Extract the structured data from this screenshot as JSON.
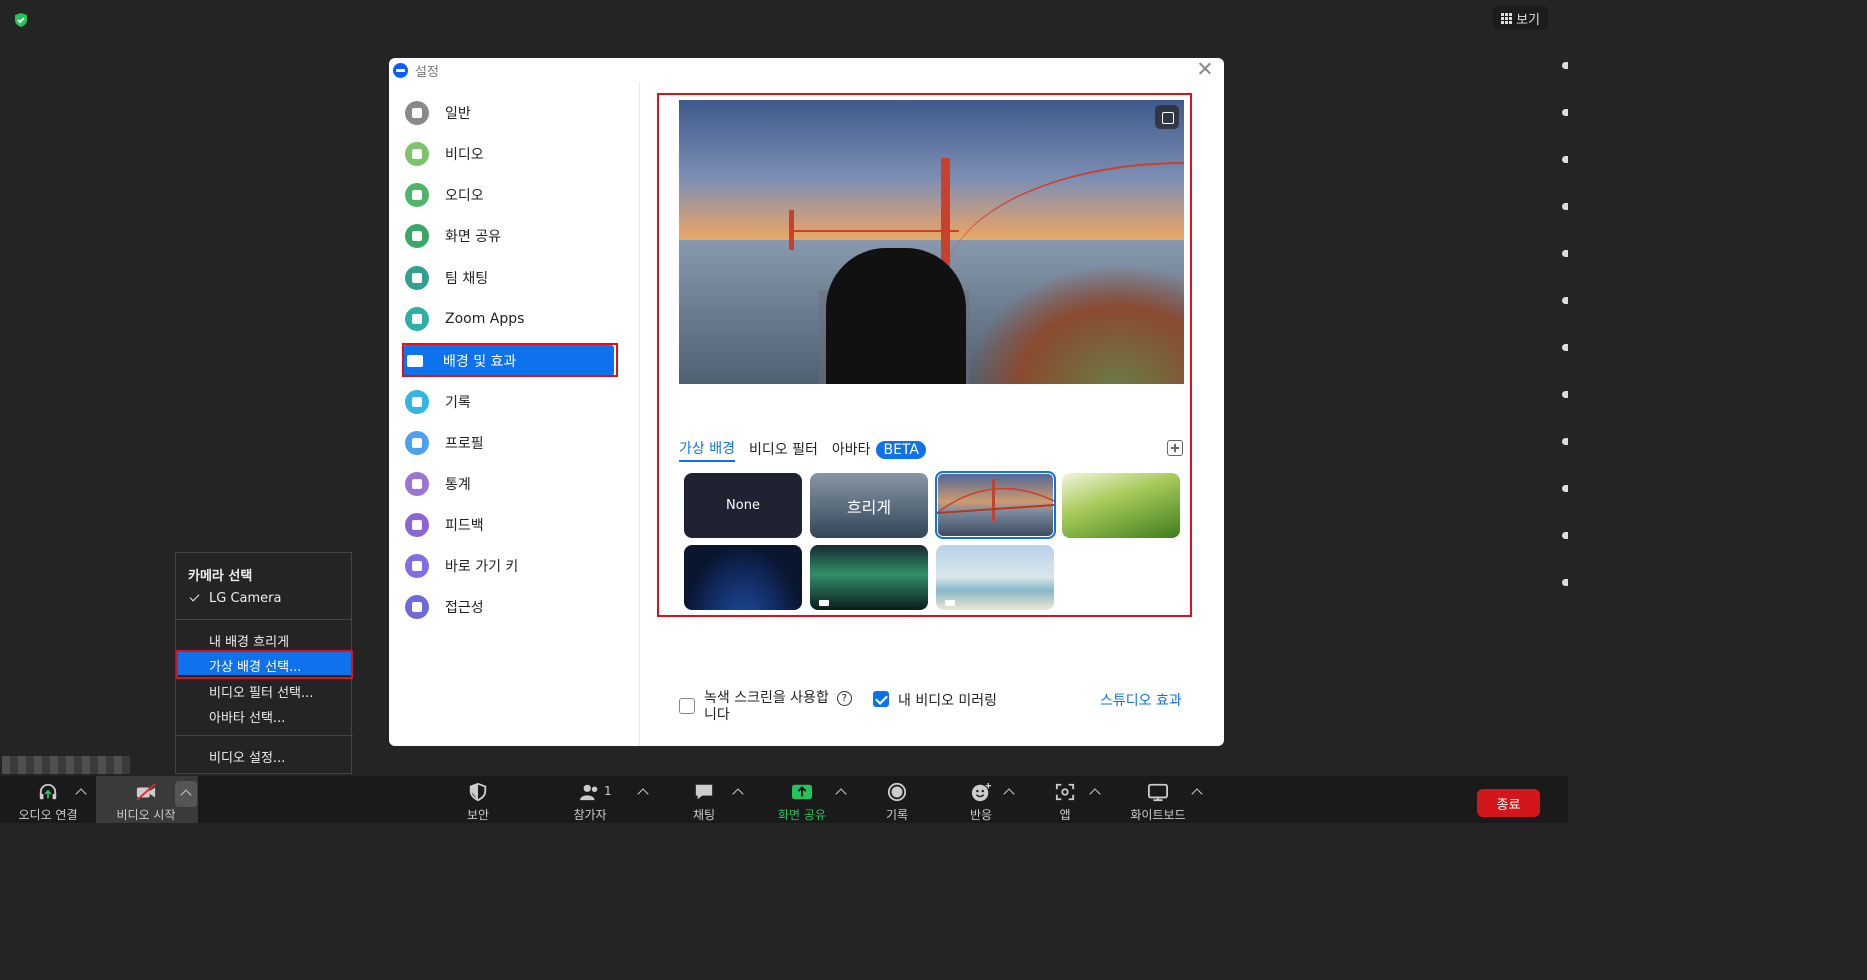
{
  "topbar": {
    "view_label": "보기"
  },
  "dialog": {
    "title": "설정",
    "nav": [
      {
        "label": "일반",
        "icon": "gear-icon",
        "color": "#8a8a8a"
      },
      {
        "label": "비디오",
        "icon": "video-icon",
        "color": "#7cc36b"
      },
      {
        "label": "오디오",
        "icon": "headphone-icon",
        "color": "#4fb56b"
      },
      {
        "label": "화면 공유",
        "icon": "share-screen-icon",
        "color": "#3aa865"
      },
      {
        "label": "팀 채팅",
        "icon": "chat-icon",
        "color": "#30a18c"
      },
      {
        "label": "Zoom Apps",
        "icon": "apps-icon",
        "color": "#2fb0a6"
      },
      {
        "label": "배경 및 효과",
        "icon": "background-icon",
        "color": "#0e72ed"
      },
      {
        "label": "기록",
        "icon": "record-icon",
        "color": "#34b6e4"
      },
      {
        "label": "프로필",
        "icon": "profile-icon",
        "color": "#4d9ff0"
      },
      {
        "label": "통계",
        "icon": "stats-icon",
        "color": "#9d74d6"
      },
      {
        "label": "피드백",
        "icon": "feedback-icon",
        "color": "#8d63d8"
      },
      {
        "label": "바로 가기 키",
        "icon": "keyboard-icon",
        "color": "#7f6ee6"
      },
      {
        "label": "접근성",
        "icon": "accessibility-icon",
        "color": "#6f6ad9"
      }
    ],
    "tabs": {
      "virtual": "가상 배경",
      "filter": "비디오 필터",
      "avatar": "아바타",
      "beta": "BETA"
    },
    "thumbs": {
      "none": "None",
      "blur": "흐리게"
    },
    "green_screen": "녹색 스크린을 사용합\n니다",
    "mirror": "내 비디오 미러링",
    "studio": "스튜디오 효과"
  },
  "menu": {
    "header": "카메라 선택",
    "camera": "LG Camera",
    "items": [
      "내 배경 흐리게",
      "가상 배경 선택...",
      "비디오 필터 선택...",
      "아바타 선택...",
      "비디오 설정..."
    ]
  },
  "toolbar": {
    "audio": "오디오 연결",
    "video": "비디오 시작",
    "security": "보안",
    "participants": "참가자",
    "participants_count": "1",
    "chat": "채팅",
    "share": "화면 공유",
    "record": "기록",
    "reactions": "반응",
    "apps": "앱",
    "whiteboard": "화이트보드",
    "end": "종료"
  }
}
